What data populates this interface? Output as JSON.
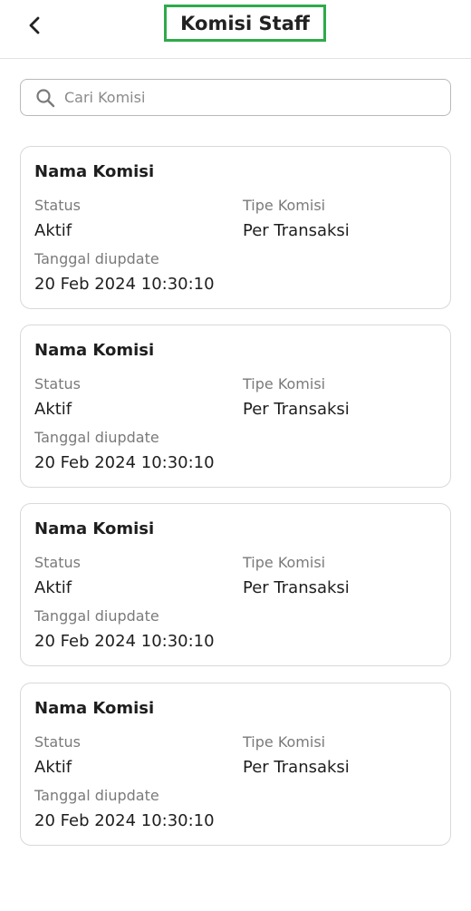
{
  "header": {
    "title": "Komisi Staff",
    "back_icon": "chevron-left-icon"
  },
  "search": {
    "placeholder": "Cari Komisi",
    "value": "",
    "icon": "search-icon"
  },
  "commissions": [
    {
      "name": "Nama Komisi",
      "status_label": "Status",
      "status": "Aktif",
      "type_label": "Tipe Komisi",
      "type": "Per Transaksi",
      "updated_label": "Tanggal diupdate",
      "updated": "20 Feb 2024 10:30:10"
    },
    {
      "name": "Nama Komisi",
      "status_label": "Status",
      "status": "Aktif",
      "type_label": "Tipe Komisi",
      "type": "Per Transaksi",
      "updated_label": "Tanggal diupdate",
      "updated": "20 Feb 2024 10:30:10"
    },
    {
      "name": "Nama Komisi",
      "status_label": "Status",
      "status": "Aktif",
      "type_label": "Tipe Komisi",
      "type": "Per Transaksi",
      "updated_label": "Tanggal diupdate",
      "updated": "20 Feb 2024 10:30:10"
    },
    {
      "name": "Nama Komisi",
      "status_label": "Status",
      "status": "Aktif",
      "type_label": "Tipe Komisi",
      "type": "Per Transaksi",
      "updated_label": "Tanggal diupdate",
      "updated": "20 Feb 2024 10:30:10"
    }
  ],
  "colors": {
    "highlight": "#2eaa4a",
    "border": "#d9d9d9",
    "label": "#7a7a7a"
  }
}
